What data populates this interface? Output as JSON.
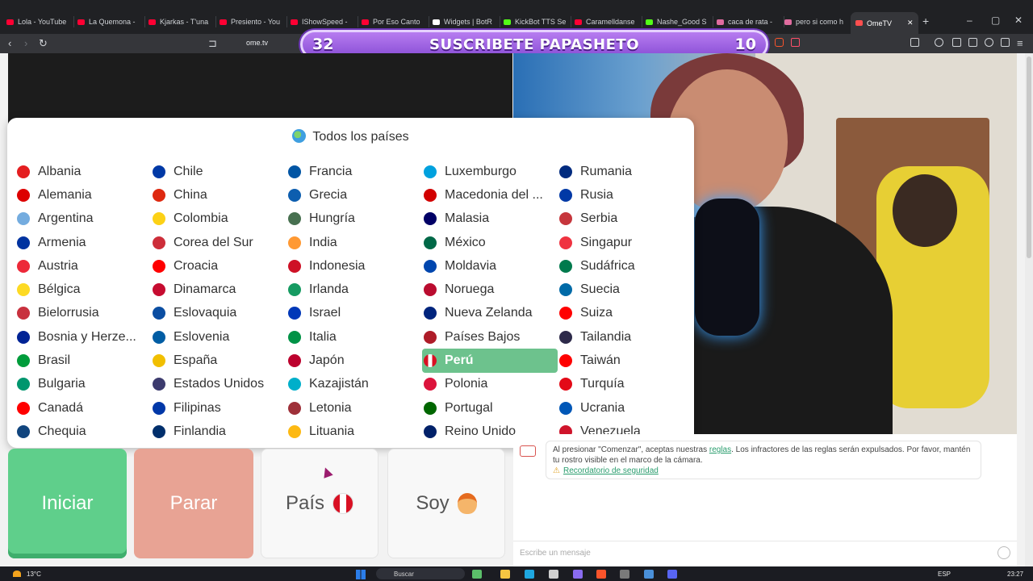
{
  "browser": {
    "tabs": [
      {
        "label": "Lola - YouTube",
        "icon": "youtube-icon",
        "color": "#ff0033"
      },
      {
        "label": "La Quemona -",
        "icon": "youtube-icon",
        "color": "#ff0033"
      },
      {
        "label": "Kjarkas - T'una",
        "icon": "youtube-icon",
        "color": "#ff0033"
      },
      {
        "label": "Presiento - You",
        "icon": "youtube-icon",
        "color": "#ff0033"
      },
      {
        "label": "IShowSpeed -",
        "icon": "youtube-icon",
        "color": "#ff0033"
      },
      {
        "label": "Por Eso Canto",
        "icon": "youtube-icon",
        "color": "#ff0033"
      },
      {
        "label": "Widgets | BotR",
        "icon": "diamond-icon",
        "color": "#ffffff"
      },
      {
        "label": "KickBot TTS Se",
        "icon": "kick-icon",
        "color": "#53fc18"
      },
      {
        "label": "Caramelldanse",
        "icon": "youtube-icon",
        "color": "#ff0033"
      },
      {
        "label": "Nashe_Good S",
        "icon": "kick-icon",
        "color": "#53fc18"
      },
      {
        "label": "caca de rata -",
        "icon": "globe-icon",
        "color": "#e06c9f"
      },
      {
        "label": "pero si como h",
        "icon": "globe-icon",
        "color": "#e06c9f"
      },
      {
        "label": "OmeTV",
        "icon": "ometv-icon",
        "color": "#ff4f4f"
      }
    ],
    "url": "ome.tv"
  },
  "overlay": {
    "left_number": "32",
    "message": "SUSCRIBETE PAPASHETO",
    "right_number": "10"
  },
  "dropdown": {
    "title": "Todos los países",
    "selected": "Perú",
    "countries": [
      {
        "name": "Albania",
        "color": "#e41e20"
      },
      {
        "name": "Alemania",
        "color": "#dd0000"
      },
      {
        "name": "Argentina",
        "color": "#74acdf"
      },
      {
        "name": "Armenia",
        "color": "#0033a0"
      },
      {
        "name": "Austria",
        "color": "#ed2939"
      },
      {
        "name": "Bélgica",
        "color": "#fdda24"
      },
      {
        "name": "Bielorrusia",
        "color": "#c8313e"
      },
      {
        "name": "Bosnia y Herze...",
        "color": "#002395"
      },
      {
        "name": "Brasil",
        "color": "#009c3b"
      },
      {
        "name": "Bulgaria",
        "color": "#00966e"
      },
      {
        "name": "Canadá",
        "color": "#ff0000"
      },
      {
        "name": "Chequia",
        "color": "#11457e"
      },
      {
        "name": "Chile",
        "color": "#0039a6"
      },
      {
        "name": "China",
        "color": "#de2910"
      },
      {
        "name": "Colombia",
        "color": "#fcd116"
      },
      {
        "name": "Corea del Sur",
        "color": "#cd2e3a"
      },
      {
        "name": "Croacia",
        "color": "#ff0000"
      },
      {
        "name": "Dinamarca",
        "color": "#c60c30"
      },
      {
        "name": "Eslovaquia",
        "color": "#0b4ea2"
      },
      {
        "name": "Eslovenia",
        "color": "#005da4"
      },
      {
        "name": "España",
        "color": "#f1bf00"
      },
      {
        "name": "Estados Unidos",
        "color": "#3c3b6e"
      },
      {
        "name": "Filipinas",
        "color": "#0038a8"
      },
      {
        "name": "Finlandia",
        "color": "#002f6c"
      },
      {
        "name": "Francia",
        "color": "#0055a4"
      },
      {
        "name": "Grecia",
        "color": "#0d5eaf"
      },
      {
        "name": "Hungría",
        "color": "#477050"
      },
      {
        "name": "India",
        "color": "#ff9933"
      },
      {
        "name": "Indonesia",
        "color": "#ce1126"
      },
      {
        "name": "Irlanda",
        "color": "#169b62"
      },
      {
        "name": "Israel",
        "color": "#0038b8"
      },
      {
        "name": "Italia",
        "color": "#009246"
      },
      {
        "name": "Japón",
        "color": "#bc002d"
      },
      {
        "name": "Kazajistán",
        "color": "#00afca"
      },
      {
        "name": "Letonia",
        "color": "#9e3039"
      },
      {
        "name": "Lituania",
        "color": "#fdb913"
      },
      {
        "name": "Luxemburgo",
        "color": "#00a1de"
      },
      {
        "name": "Macedonia del ...",
        "color": "#d20000"
      },
      {
        "name": "Malasia",
        "color": "#010066"
      },
      {
        "name": "México",
        "color": "#006847"
      },
      {
        "name": "Moldavia",
        "color": "#0046ae"
      },
      {
        "name": "Noruega",
        "color": "#ba0c2f"
      },
      {
        "name": "Nueva Zelanda",
        "color": "#00247d"
      },
      {
        "name": "Países Bajos",
        "color": "#ae1c28"
      },
      {
        "name": "Perú",
        "color": "#d91023"
      },
      {
        "name": "Polonia",
        "color": "#dc143c"
      },
      {
        "name": "Portugal",
        "color": "#006600"
      },
      {
        "name": "Reino Unido",
        "color": "#012169"
      },
      {
        "name": "Rumania",
        "color": "#002b7f"
      },
      {
        "name": "Rusia",
        "color": "#0039a6"
      },
      {
        "name": "Serbia",
        "color": "#c6363c"
      },
      {
        "name": "Singapur",
        "color": "#ef3340"
      },
      {
        "name": "Sudáfrica",
        "color": "#007a4d"
      },
      {
        "name": "Suecia",
        "color": "#006aa7"
      },
      {
        "name": "Suiza",
        "color": "#ff0000"
      },
      {
        "name": "Tailandia",
        "color": "#2d2a4a"
      },
      {
        "name": "Taiwán",
        "color": "#fe0000"
      },
      {
        "name": "Turquía",
        "color": "#e30a17"
      },
      {
        "name": "Ucrania",
        "color": "#0057b7"
      },
      {
        "name": "Venezuela",
        "color": "#cf142b"
      }
    ]
  },
  "controls": {
    "start": "Iniciar",
    "stop": "Parar",
    "country": "País",
    "me": "Soy"
  },
  "chat": {
    "rules_prefix": "Al presionar \"Comenzar\", aceptas nuestras ",
    "rules_link": "reglas",
    "rules_suffix": ". Los infractores de las reglas serán expulsados. Por favor, mantén tu rostro visible en el marco de la cámara.",
    "safety_link": "Recordatorio de seguridad",
    "message_placeholder": "Escribe un mensaje"
  },
  "taskbar": {
    "temperature": "13°C",
    "search_placeholder": "Buscar",
    "language": "ESP",
    "time": "23:27"
  },
  "colors": {
    "accent_green": "#5fcf8b",
    "stop_red": "#e8a394",
    "selected_green": "#6dc28d",
    "banner_purple": "#8a4fd6"
  }
}
